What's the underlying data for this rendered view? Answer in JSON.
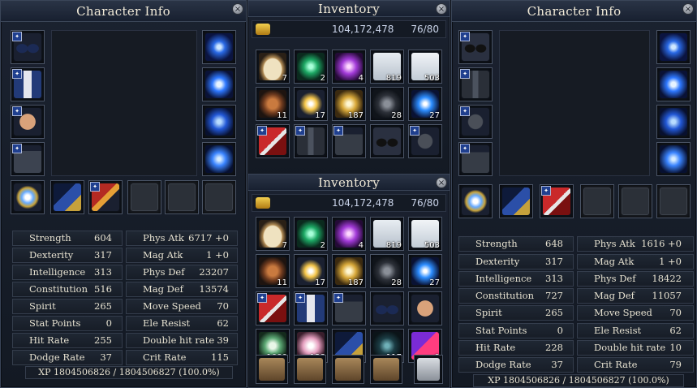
{
  "left_panel": {
    "title": "Character Info",
    "close": "×",
    "stats": [
      {
        "label": "Strength",
        "value": "604"
      },
      {
        "label": "Phys Atk",
        "value": "6717 +0"
      },
      {
        "label": "Dexterity",
        "value": "317"
      },
      {
        "label": "Mag Atk",
        "value": "1 +0"
      },
      {
        "label": "Intelligence",
        "value": "313"
      },
      {
        "label": "Phys Def",
        "value": "23207"
      },
      {
        "label": "Constitution",
        "value": "516"
      },
      {
        "label": "Mag Def",
        "value": "13574"
      },
      {
        "label": "Spirit",
        "value": "265"
      },
      {
        "label": "Move Speed",
        "value": "70"
      },
      {
        "label": "Stat Points",
        "value": "0"
      },
      {
        "label": "Ele Resist",
        "value": "62"
      },
      {
        "label": "Hit Rate",
        "value": "255"
      },
      {
        "label": "Double hit rate",
        "value": "39"
      },
      {
        "label": "Dodge Rate",
        "value": "37"
      },
      {
        "label": "Crit Rate",
        "value": "115"
      }
    ],
    "xp": "XP 1804506826 / 1804506827 (100.0%)"
  },
  "right_panel": {
    "title": "Character Info",
    "close": "×",
    "stats": [
      {
        "label": "Strength",
        "value": "648"
      },
      {
        "label": "Phys Atk",
        "value": "1616 +0"
      },
      {
        "label": "Dexterity",
        "value": "317"
      },
      {
        "label": "Mag Atk",
        "value": "1 +0"
      },
      {
        "label": "Intelligence",
        "value": "313"
      },
      {
        "label": "Phys Def",
        "value": "18422"
      },
      {
        "label": "Constitution",
        "value": "727"
      },
      {
        "label": "Mag Def",
        "value": "11057"
      },
      {
        "label": "Spirit",
        "value": "265"
      },
      {
        "label": "Move Speed",
        "value": "70"
      },
      {
        "label": "Stat Points",
        "value": "0"
      },
      {
        "label": "Ele Resist",
        "value": "62"
      },
      {
        "label": "Hit Rate",
        "value": "228"
      },
      {
        "label": "Double hit rate",
        "value": "10"
      },
      {
        "label": "Dodge Rate",
        "value": "37"
      },
      {
        "label": "Crit Rate",
        "value": "79"
      }
    ],
    "xp": "XP 1804506826 / 1804506827 (100.0%)"
  },
  "inventory_top": {
    "title": "Inventory",
    "close": "×",
    "gold": "104,172,478",
    "capacity": "76/80",
    "counts": [
      "7",
      "2",
      "4",
      "819",
      "503",
      "11",
      "17",
      "187",
      "28",
      "27"
    ]
  },
  "inventory_bottom": {
    "title": "Inventory",
    "close": "×",
    "gold": "104,172,478",
    "capacity": "76/80",
    "counts": [
      "7",
      "2",
      "4",
      "819",
      "503",
      "11",
      "17",
      "187",
      "28",
      "27",
      "",
      "",
      "",
      "",
      "",
      "1000",
      "128",
      "",
      "117",
      "9"
    ]
  },
  "colors": {
    "panel_bg": "#1b2230",
    "border": "#3a4558",
    "text": "#e9e4d4",
    "gold": "#f2cf4f"
  }
}
